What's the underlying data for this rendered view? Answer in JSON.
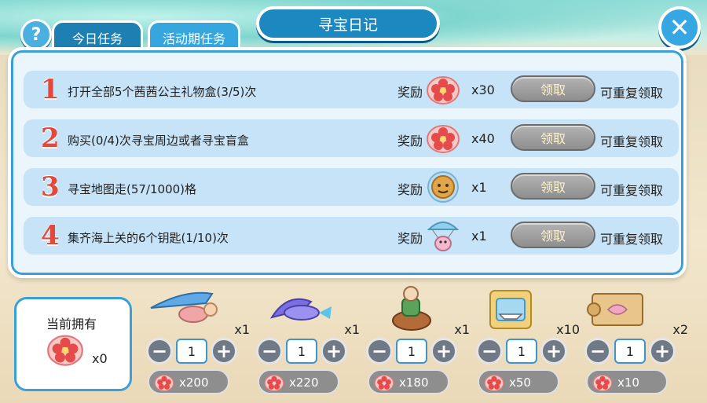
{
  "header": {
    "help_icon": "question-icon",
    "tabs": [
      {
        "label": "今日任务"
      },
      {
        "label": "活动期任务"
      }
    ],
    "title": "寻宝日记",
    "close_icon": "close-x-icon"
  },
  "tasks": [
    {
      "num": "1",
      "desc": "打开全部5个茜茜公主礼物盒(3/5)次",
      "reward_label": "奖励",
      "reward_icon": "red-flower-shell-icon",
      "qty": "x30",
      "button": "领取",
      "repeat": "可重复领取"
    },
    {
      "num": "2",
      "desc": "购买(0/4)次寻宝周边或者寻宝盲盒",
      "reward_label": "奖励",
      "reward_icon": "red-flower-shell-icon",
      "qty": "x40",
      "button": "领取",
      "repeat": "可重复领取"
    },
    {
      "num": "3",
      "desc": "寻宝地图走(57/1000)格",
      "reward_label": "奖励",
      "reward_icon": "golden-orb-icon",
      "qty": "x1",
      "button": "领取",
      "repeat": "可重复领取"
    },
    {
      "num": "4",
      "desc": "集齐海上关的6个钥匙(1/10)次",
      "reward_label": "奖励",
      "reward_icon": "parachute-fish-icon",
      "qty": "x1",
      "button": "领取",
      "repeat": "可重复领取"
    }
  ],
  "owned": {
    "label": "当前拥有",
    "icon": "red-flower-shell-icon",
    "count": "x0"
  },
  "shop": [
    {
      "icon": "glider-icon",
      "mult": "x1",
      "value": "1",
      "price": "x200"
    },
    {
      "icon": "flying-fish-icon",
      "mult": "x1",
      "value": "1",
      "price": "x220"
    },
    {
      "icon": "rider-character-icon",
      "mult": "x1",
      "value": "1",
      "price": "x180"
    },
    {
      "icon": "puzzle-ship-icon",
      "mult": "x10",
      "value": "1",
      "price": "x50"
    },
    {
      "icon": "treasure-map-icon",
      "mult": "x2",
      "value": "1",
      "price": "x10"
    }
  ],
  "colors": {
    "accent": "#1b88c0",
    "row": "#c7e3f7",
    "number": "#e4473b",
    "button_disabled": "#8e8e8e"
  }
}
